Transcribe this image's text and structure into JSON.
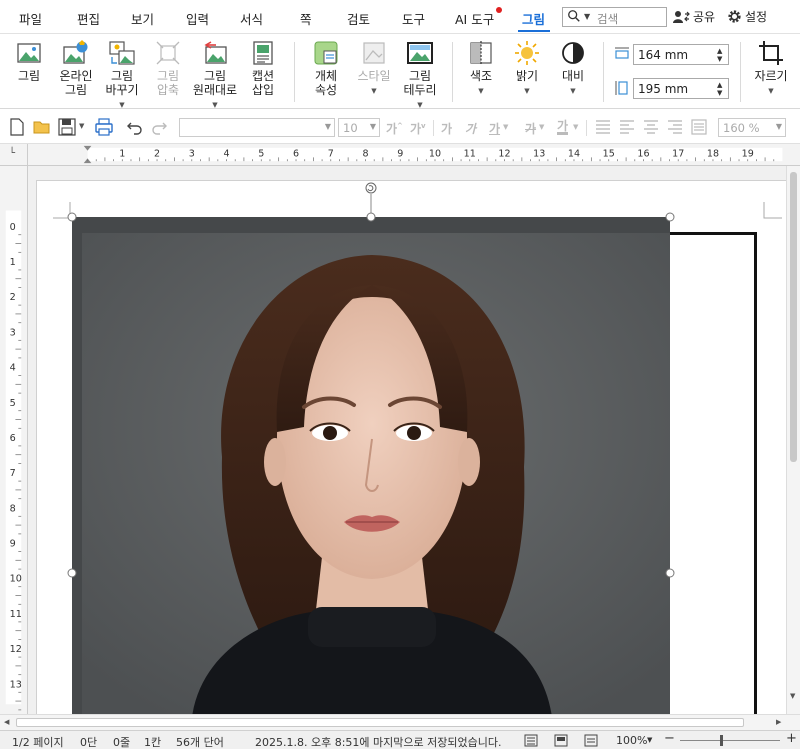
{
  "menu": {
    "items": [
      "파일",
      "편집",
      "보기",
      "입력",
      "서식",
      "쪽",
      "검토",
      "도구",
      "AI 도구",
      "그림"
    ],
    "active": "그림",
    "search_placeholder": "검색",
    "share_label": "공유",
    "settings_label": "설정"
  },
  "ribbon": {
    "picture": "그림",
    "online_picture_1": "온라인",
    "online_picture_2": "그림",
    "change_picture_1": "그림",
    "change_picture_2": "바꾸기",
    "compress_1": "그림",
    "compress_2": "압축",
    "reset_1": "그림",
    "reset_2": "원래대로",
    "caption_1": "캡션",
    "caption_2": "삽입",
    "object_props_1": "개체",
    "object_props_2": "속성",
    "style": "스타일",
    "border_1": "그림",
    "border_2": "테두리",
    "color_tone": "색조",
    "brightness": "밝기",
    "contrast": "대비",
    "width_value": "164 mm",
    "height_value": "195 mm",
    "crop": "자르기"
  },
  "toolbar": {
    "font_size": "10",
    "bold": "가",
    "italic": "가",
    "underline": "가",
    "strike": "가",
    "highlight": "가",
    "zoom": "160 %"
  },
  "ruler": {
    "h_ticks": [
      "1",
      "2",
      "3",
      "4",
      "5",
      "6",
      "7",
      "8",
      "9",
      "10",
      "11",
      "12",
      "13",
      "14",
      "15",
      "16",
      "17",
      "18",
      "19"
    ],
    "v_ticks": [
      "0",
      "1",
      "2",
      "3",
      "4",
      "5",
      "6",
      "7",
      "8",
      "9",
      "10",
      "11",
      "12",
      "13"
    ]
  },
  "status": {
    "page": "1/2 페이지",
    "column": "0단",
    "line": "0줄",
    "char": "1칸",
    "words": "56개 단어",
    "saved": "2025.1.8. 오후 8:51에 마지막으로 저장되었습니다.",
    "zoom": "100%"
  },
  "colors": {
    "accent": "#1a6fd8",
    "photo_background": "#5a5d5f",
    "sweater": "#14161a",
    "hair": "#3e2519",
    "skin": "#e9c5b1"
  }
}
